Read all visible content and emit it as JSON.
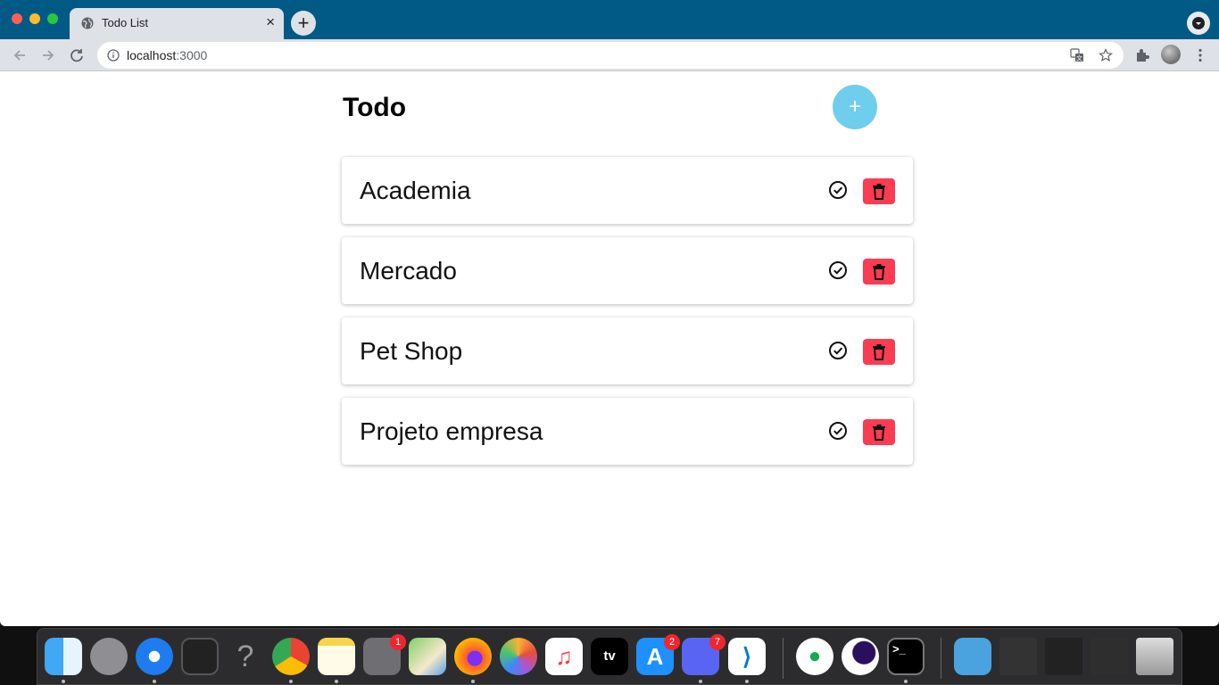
{
  "browser": {
    "tab": {
      "title": "Todo List",
      "close": "×"
    },
    "new_tab": "+",
    "address": {
      "host": "localhost",
      "port": ":3000"
    }
  },
  "app": {
    "title": "Todo",
    "add_label": "+",
    "todos": [
      {
        "text": "Academia"
      },
      {
        "text": "Mercado"
      },
      {
        "text": "Pet Shop"
      },
      {
        "text": "Projeto empresa"
      }
    ],
    "colors": {
      "add": "#6fcdee",
      "delete": "#fd3b51"
    }
  },
  "dock": {
    "apps": [
      {
        "name": "Finder",
        "icon": "finder-icon"
      },
      {
        "name": "Launchpad",
        "icon": "launchpad-icon"
      },
      {
        "name": "Safari",
        "icon": "safari-icon"
      },
      {
        "name": "Mission Control",
        "icon": "mission-control-icon"
      },
      {
        "name": "Help",
        "icon": "question-icon"
      },
      {
        "name": "Chrome",
        "icon": "chrome-icon"
      },
      {
        "name": "Notes",
        "icon": "notes-icon"
      },
      {
        "name": "System Preferences",
        "icon": "gear-icon",
        "badge": "1"
      },
      {
        "name": "Maps",
        "icon": "maps-icon"
      },
      {
        "name": "Firefox",
        "icon": "firefox-icon"
      },
      {
        "name": "Photos",
        "icon": "photos-icon"
      },
      {
        "name": "Music",
        "icon": "music-icon"
      },
      {
        "name": "TV",
        "icon": "tv-icon",
        "label": "tv"
      },
      {
        "name": "App Store",
        "icon": "app-store-icon",
        "badge": "2"
      },
      {
        "name": "Discord",
        "icon": "discord-icon",
        "badge": "7"
      },
      {
        "name": "VS Code",
        "icon": "vscode-icon"
      },
      {
        "name": "MongoDB Compass",
        "icon": "mongodb-icon"
      },
      {
        "name": "Hyper",
        "icon": "hyper-icon"
      },
      {
        "name": "Terminal",
        "icon": "terminal-icon",
        "label": ">_"
      }
    ]
  }
}
